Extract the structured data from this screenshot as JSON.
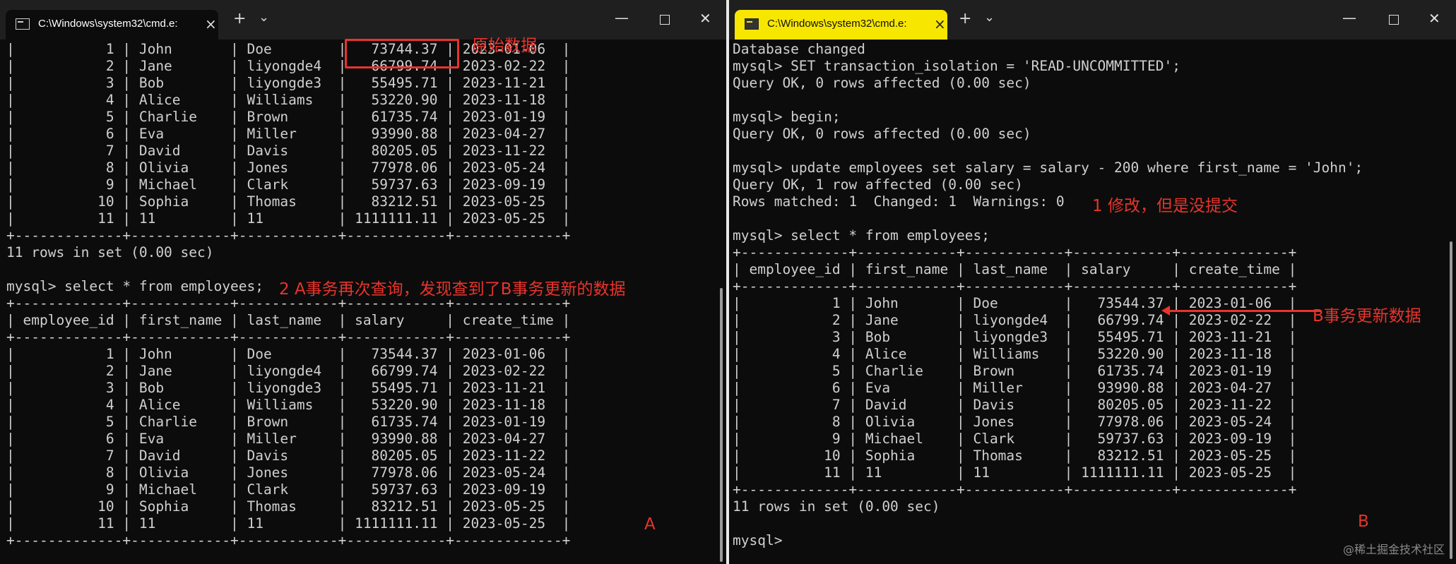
{
  "colors": {
    "terminal_bg": "#0c0c0c",
    "terminal_text": "#d0d0d0",
    "titlebar_bg": "#1f1f1f",
    "active_tab_highlight": "#f7e600",
    "annotation": "#e8342c"
  },
  "windowA": {
    "tab_title": "C:\\Windows\\system32\\cmd.e:",
    "tab_close": "×",
    "new_tab": "+",
    "dropdown": "⌄",
    "minimize": "—",
    "close": "✕",
    "lines": [
      "|           1 | John       | Doe        |   73744.37 | 2023-01-06  |",
      "|           2 | Jane       | liyongde4  |   66799.74 | 2023-02-22  |",
      "|           3 | Bob        | liyongde3  |   55495.71 | 2023-11-21  |",
      "|           4 | Alice      | Williams   |   53220.90 | 2023-11-18  |",
      "|           5 | Charlie    | Brown      |   61735.74 | 2023-01-19  |",
      "|           6 | Eva        | Miller     |   93990.88 | 2023-04-27  |",
      "|           7 | David      | Davis      |   80205.05 | 2023-11-22  |",
      "|           8 | Olivia     | Jones      |   77978.06 | 2023-05-24  |",
      "|           9 | Michael    | Clark      |   59737.63 | 2023-09-19  |",
      "|          10 | Sophia     | Thomas     |   83212.51 | 2023-05-25  |",
      "|          11 | 11         | 11         | 1111111.11 | 2023-05-25  |",
      "+-------------+------------+------------+------------+-------------+",
      "11 rows in set (0.00 sec)",
      "",
      "mysql> select * from employees;",
      "+-------------+------------+------------+------------+-------------+",
      "| employee_id | first_name | last_name  | salary     | create_time |",
      "+-------------+------------+------------+------------+-------------+",
      "|           1 | John       | Doe        |   73544.37 | 2023-01-06  |",
      "|           2 | Jane       | liyongde4  |   66799.74 | 2023-02-22  |",
      "|           3 | Bob        | liyongde3  |   55495.71 | 2023-11-21  |",
      "|           4 | Alice      | Williams   |   53220.90 | 2023-11-18  |",
      "|           5 | Charlie    | Brown      |   61735.74 | 2023-01-19  |",
      "|           6 | Eva        | Miller     |   93990.88 | 2023-04-27  |",
      "|           7 | David      | Davis      |   80205.05 | 2023-11-22  |",
      "|           8 | Olivia     | Jones      |   77978.06 | 2023-05-24  |",
      "|           9 | Michael    | Clark      |   59737.63 | 2023-09-19  |",
      "|          10 | Sophia     | Thomas     |   83212.51 | 2023-05-25  |",
      "|          11 | 11         | 11         | 1111111.11 | 2023-05-25  |",
      "+-------------+------------+------------+------------+-------------+"
    ],
    "annotations": {
      "original_data": "原始数据",
      "step2": "2 A事务再次查询，发现查到了B事务更新的数据",
      "label": "A"
    }
  },
  "windowB": {
    "tab_title": "C:\\Windows\\system32\\cmd.e:",
    "tab_close": "×",
    "new_tab": "+",
    "dropdown": "⌄",
    "minimize": "—",
    "close": "✕",
    "lines": [
      "Database changed",
      "mysql> SET transaction_isolation = 'READ-UNCOMMITTED';",
      "Query OK, 0 rows affected (0.00 sec)",
      "",
      "mysql> begin;",
      "Query OK, 0 rows affected (0.00 sec)",
      "",
      "mysql> update employees set salary = salary - 200 where first_name = 'John';",
      "Query OK, 1 row affected (0.00 sec)",
      "Rows matched: 1  Changed: 1  Warnings: 0",
      "",
      "mysql> select * from employees;",
      "+-------------+------------+------------+------------+-------------+",
      "| employee_id | first_name | last_name  | salary     | create_time |",
      "+-------------+------------+------------+------------+-------------+",
      "|           1 | John       | Doe        |   73544.37 | 2023-01-06  |",
      "|           2 | Jane       | liyongde4  |   66799.74 | 2023-02-22  |",
      "|           3 | Bob        | liyongde3  |   55495.71 | 2023-11-21  |",
      "|           4 | Alice      | Williams   |   53220.90 | 2023-11-18  |",
      "|           5 | Charlie    | Brown      |   61735.74 | 2023-01-19  |",
      "|           6 | Eva        | Miller     |   93990.88 | 2023-04-27  |",
      "|           7 | David      | Davis      |   80205.05 | 2023-11-22  |",
      "|           8 | Olivia     | Jones      |   77978.06 | 2023-05-24  |",
      "|           9 | Michael    | Clark      |   59737.63 | 2023-09-19  |",
      "|          10 | Sophia     | Thomas     |   83212.51 | 2023-05-25  |",
      "|          11 | 11         | 11         | 1111111.11 | 2023-05-25  |",
      "+-------------+------------+------------+------------+-------------+",
      "11 rows in set (0.00 sec)",
      "",
      "mysql>"
    ],
    "annotations": {
      "step1": "1 修改，但是没提交",
      "b_updated": "B事务更新数据",
      "label": "B"
    }
  },
  "watermark": "@稀土掘金技术社区"
}
